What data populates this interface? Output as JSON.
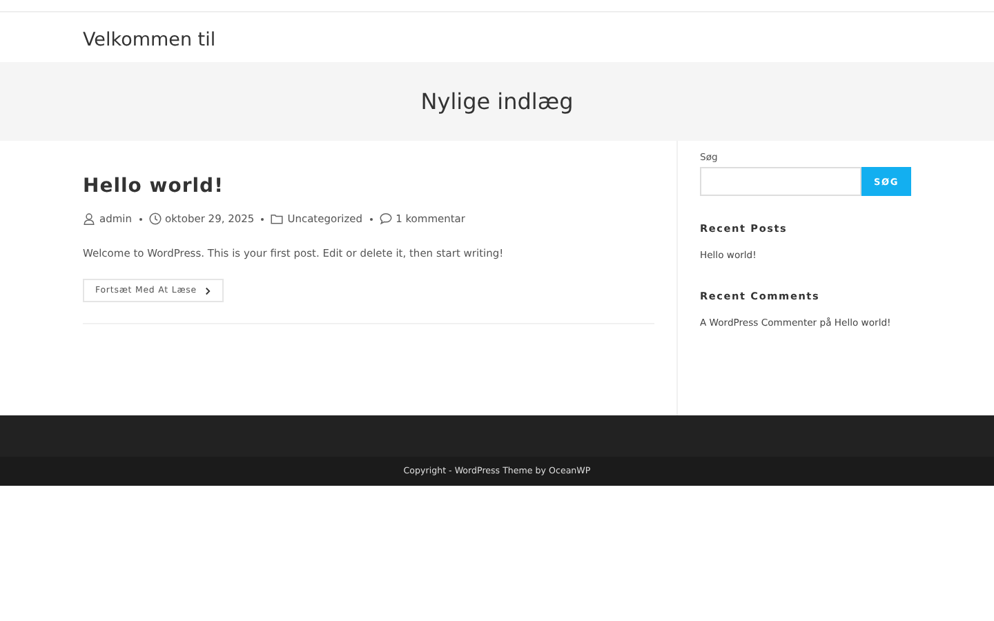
{
  "header": {
    "site_title": "Velkommen til"
  },
  "page_title": "Nylige indlæg",
  "posts": [
    {
      "title": "Hello world!",
      "meta": [
        {
          "kind": "author",
          "text": "admin"
        },
        {
          "kind": "date",
          "text": "oktober 29, 2025"
        },
        {
          "kind": "category",
          "text": "Uncategorized"
        },
        {
          "kind": "comments",
          "text": "1 kommentar"
        }
      ],
      "excerpt": "Welcome to WordPress. This is your first post. Edit or delete it, then start writing!",
      "read_more": "Fortsæt Med At Læse"
    }
  ],
  "sidebar": {
    "search_label": "Søg",
    "search_button": "SØG",
    "recent_posts_title": "Recent Posts",
    "recent_posts": [
      "Hello world!"
    ],
    "recent_comments_title": "Recent Comments",
    "recent_comments": [
      {
        "author": "A WordPress Commenter",
        "connector": "på",
        "post": "Hello world!"
      }
    ]
  },
  "footer": {
    "copyright": "Copyright - WordPress Theme by OceanWP"
  }
}
